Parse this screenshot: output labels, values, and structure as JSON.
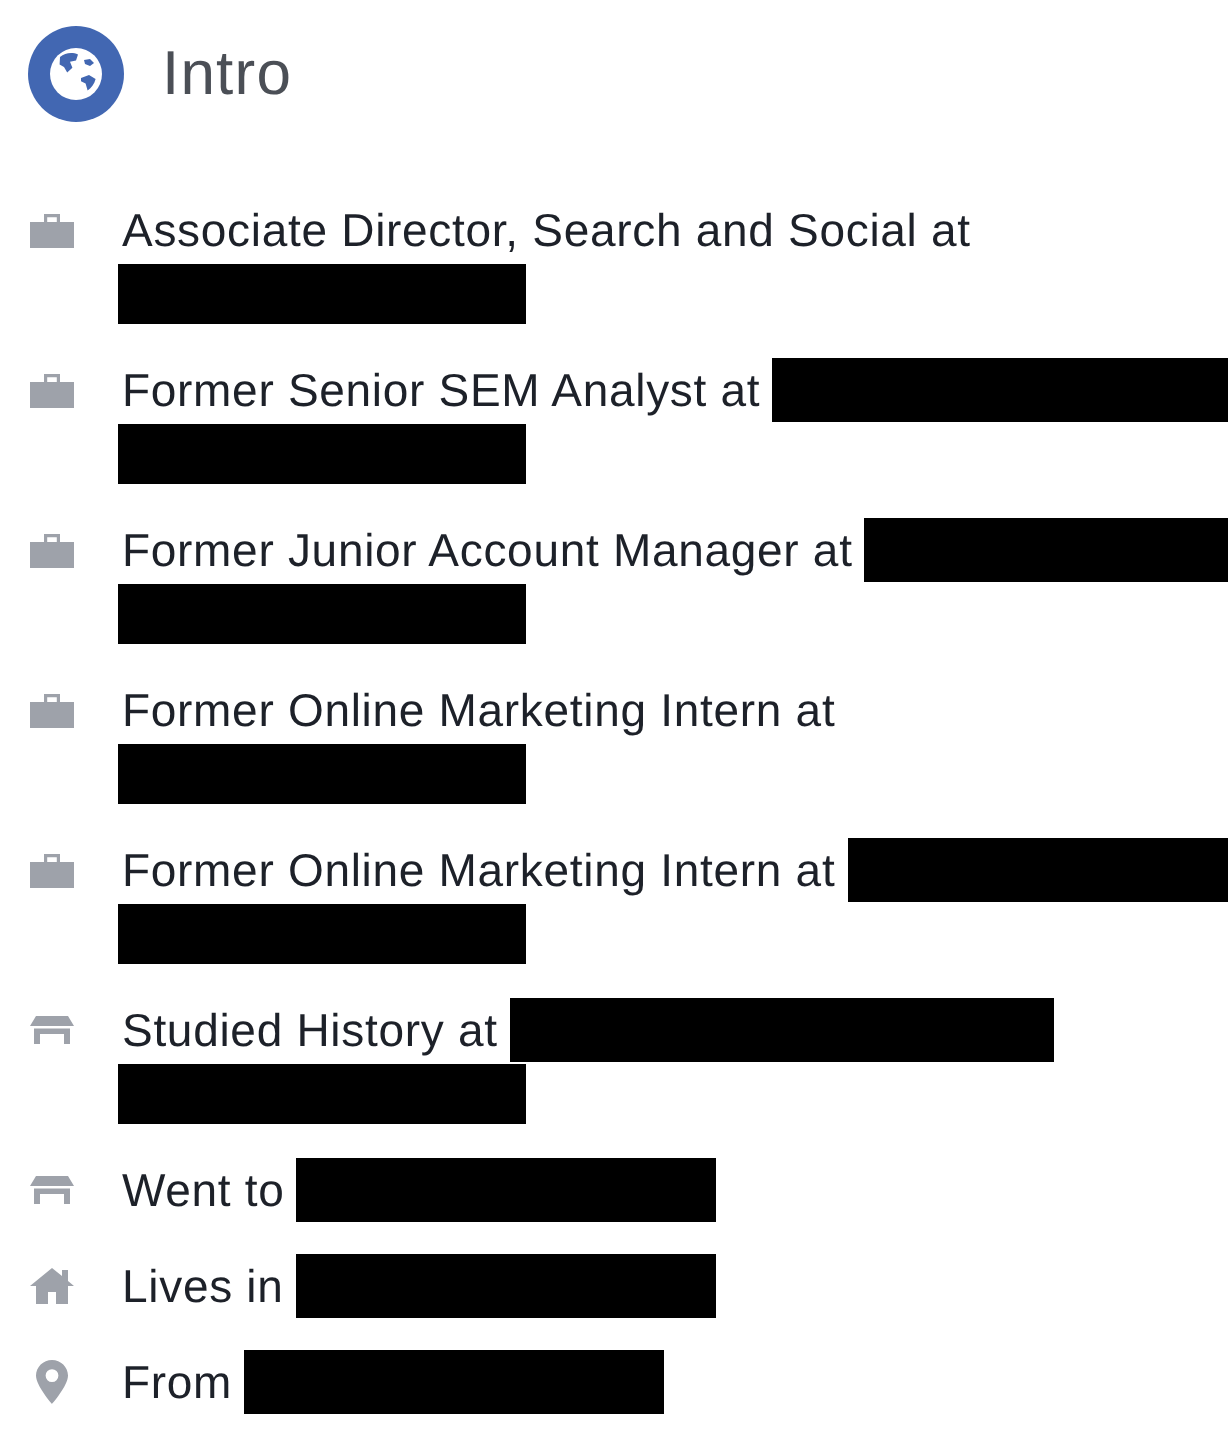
{
  "header": {
    "title": "Intro"
  },
  "items": [
    {
      "kind": "work",
      "text": "Associate Director, Search and Social at",
      "redacted_same_line": false,
      "redacted_next_line": true
    },
    {
      "kind": "work",
      "text": "Former Senior SEM Analyst at",
      "redacted_same_line": true,
      "redacted_next_line": true
    },
    {
      "kind": "work",
      "text": "Former Junior Account Manager at",
      "redacted_same_line": true,
      "redacted_next_line": true
    },
    {
      "kind": "work",
      "text": "Former Online Marketing Intern at",
      "redacted_same_line": false,
      "redacted_next_line": true
    },
    {
      "kind": "work",
      "text": "Former Online Marketing Intern at",
      "redacted_same_line": true,
      "redacted_next_line": true
    },
    {
      "kind": "education",
      "text": "Studied History at",
      "redacted_same_line": true,
      "redacted_next_line": true
    },
    {
      "kind": "education",
      "text": "Went to",
      "redacted_same_line": true,
      "redacted_next_line": false
    },
    {
      "kind": "home",
      "text": "Lives in",
      "redacted_same_line": true,
      "redacted_next_line": false
    },
    {
      "kind": "hometown",
      "text": "From",
      "redacted_same_line": true,
      "redacted_next_line": false
    }
  ]
}
